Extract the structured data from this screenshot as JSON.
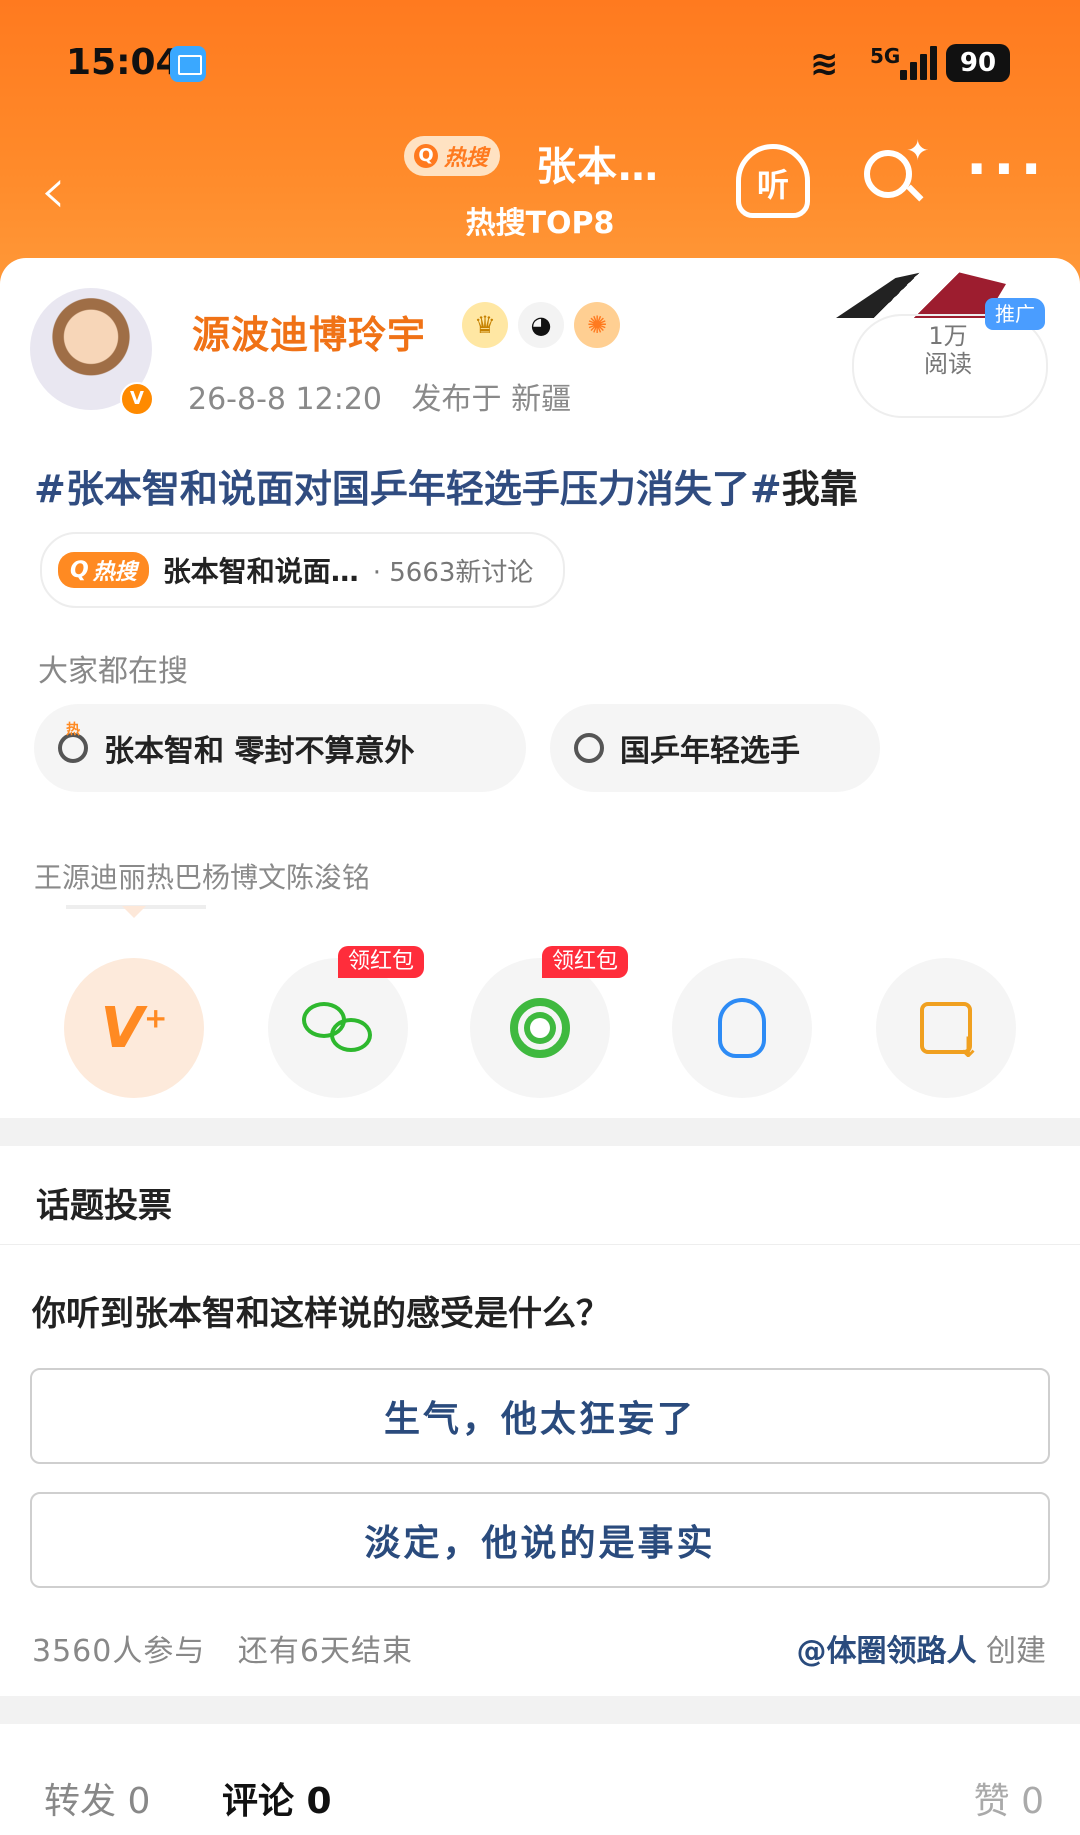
{
  "status": {
    "time": "15:04",
    "network": "5G",
    "battery": "90"
  },
  "nav": {
    "hot_pill": "热搜",
    "title": "张本…",
    "subtitle": "热搜TOP8",
    "listen_label": "听"
  },
  "post": {
    "author": "源波迪博玲宇",
    "meta_time": "26-8-8 12:20",
    "meta_location": "发布于 新疆",
    "ad_tag": "推广",
    "reads": "1万",
    "reads_label": "阅读",
    "topic_text": "#张本智和说面对国乒年轻选手压力消失了#",
    "topic_tail": "我靠",
    "hot_chip": {
      "label": "热搜",
      "title": "张本智和说面…",
      "meta": "· 5663新讨论"
    }
  },
  "searches": {
    "label": "大家都在搜",
    "items": [
      "张本智和 零封不算意外",
      "国乒年轻选手"
    ]
  },
  "tag_line": "王源迪丽热巴杨博文陈浚铭",
  "share": {
    "redpack_label": "领红包"
  },
  "vote": {
    "section_title": "话题投票",
    "question": "你听到张本智和这样说的感受是什么？",
    "options": [
      "生气，他太狂妄了",
      "淡定，他说的是事实"
    ],
    "participants": "3560人参与",
    "remaining": "还有6天结束",
    "creator": "@体圈领路人",
    "creator_suffix": "创建"
  },
  "actions": {
    "repost": "转发 0",
    "comment": "评论 0",
    "like": "赞 0"
  }
}
